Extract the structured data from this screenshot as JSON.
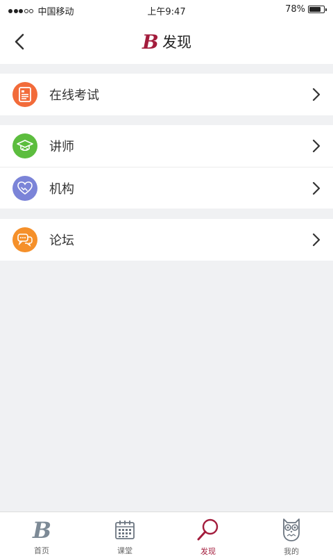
{
  "status_bar": {
    "carrier": "中国移动",
    "time": "上午9:47",
    "battery": "78%",
    "battery_level": 0.78
  },
  "nav": {
    "title": "发现",
    "logo_letter": "B"
  },
  "colors": {
    "brand": "#a31c3c",
    "exam_icon_bg": "#f26b3a",
    "teacher_icon_bg": "#5cbd3e",
    "org_icon_bg": "#7b84d8",
    "forum_icon_bg": "#f5902a",
    "background": "#f0f1f3"
  },
  "groups": [
    {
      "items": [
        {
          "label": "在线考试",
          "icon": "exam-paper-icon"
        }
      ]
    },
    {
      "items": [
        {
          "label": "讲师",
          "icon": "graduation-cap-icon"
        },
        {
          "label": "机构",
          "icon": "handshake-heart-icon"
        }
      ]
    },
    {
      "items": [
        {
          "label": "论坛",
          "icon": "chat-bubbles-icon"
        }
      ]
    }
  ],
  "tabs": [
    {
      "label": "首页",
      "icon": "home-b-logo-icon"
    },
    {
      "label": "课堂",
      "icon": "calendar-icon"
    },
    {
      "label": "发现",
      "icon": "magnifier-icon",
      "active": true
    },
    {
      "label": "我的",
      "icon": "owl-icon"
    }
  ]
}
